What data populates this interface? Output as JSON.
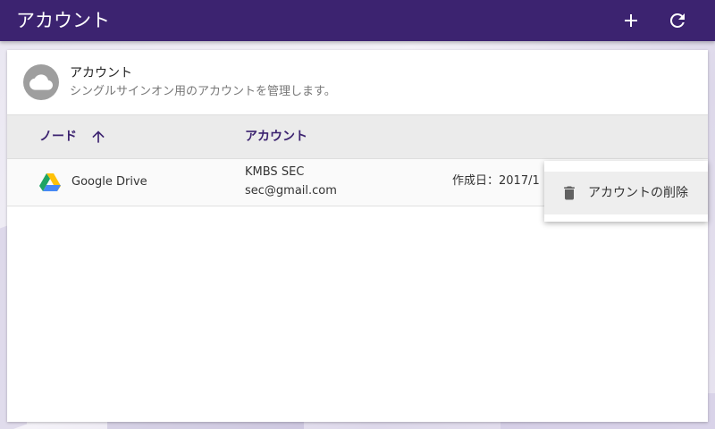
{
  "app": {
    "title": "アカウント",
    "accent_color": "#3c2370"
  },
  "toolbar": {
    "add_icon": "plus-icon",
    "refresh_icon": "refresh-icon"
  },
  "card": {
    "icon": "cloud-icon",
    "title": "アカウント",
    "subtitle": "シングルサインオン用のアカウントを管理します。"
  },
  "table": {
    "columns": [
      {
        "label": "ノード",
        "sort": "ascending"
      },
      {
        "label": "アカウント"
      }
    ],
    "rows": [
      {
        "node_icon": "google-drive-icon",
        "node": "Google Drive",
        "account_name": "KMBS SEC",
        "account_email": "sec@gmail.com",
        "created": "作成日：2017/1"
      }
    ]
  },
  "context_menu": {
    "items": [
      {
        "icon": "trash-icon",
        "label": "アカウントの削除"
      }
    ]
  }
}
